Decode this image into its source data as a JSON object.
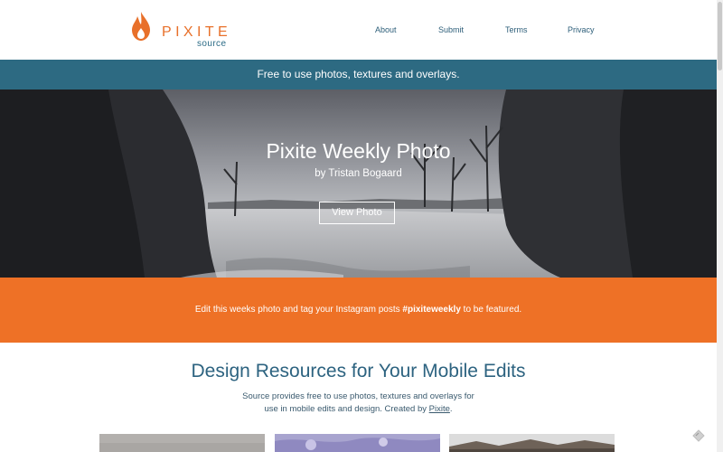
{
  "header": {
    "logo_word": "PIXITE",
    "logo_sub": "source",
    "nav": [
      {
        "label": "About"
      },
      {
        "label": "Submit"
      },
      {
        "label": "Terms"
      },
      {
        "label": "Privacy"
      }
    ]
  },
  "banner": {
    "text": "Free to use photos, textures and overlays."
  },
  "hero": {
    "title": "Pixite Weekly Photo",
    "byline": "by Tristan Bogaard",
    "button_label": "View Photo"
  },
  "promo": {
    "text_before": "Edit this weeks photo and tag your Instagram posts ",
    "hashtag": "#pixiteweekly",
    "text_after": " to be featured."
  },
  "section": {
    "title": "Design Resources for Your Mobile Edits",
    "desc_line1": "Source provides free to use photos, textures and overlays for",
    "desc_line2_before": "use in mobile edits and design. Created by ",
    "desc_link": "Pixite",
    "desc_line2_after": "."
  },
  "colors": {
    "brand_orange": "#ee7126",
    "brand_blue": "#2d6a82",
    "title_blue": "#2d6380"
  },
  "icons": {
    "logo": "flame-drop-icon",
    "corner": "tag-icon"
  }
}
